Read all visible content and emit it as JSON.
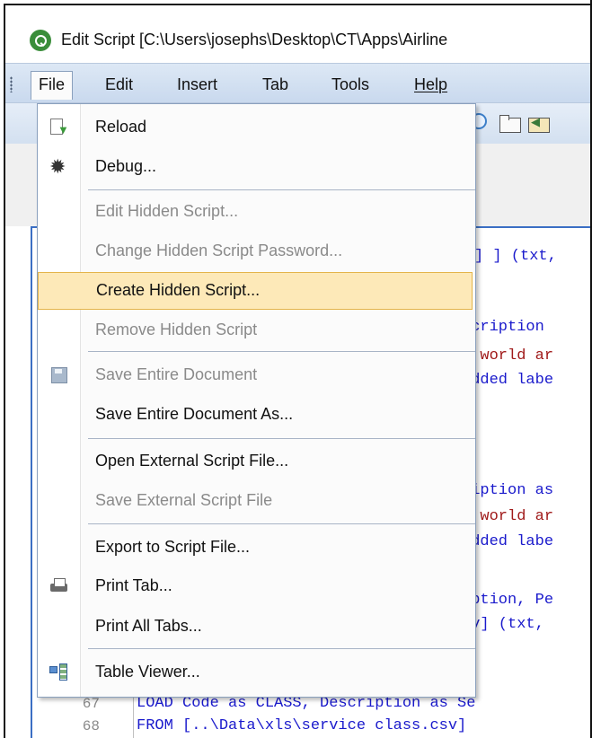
{
  "window": {
    "title": "Edit Script [C:\\Users\\josephs\\Desktop\\CT\\Apps\\Airline"
  },
  "menubar": {
    "items": [
      "File",
      "Edit",
      "Insert",
      "Tab",
      "Tools",
      "Help"
    ]
  },
  "file_menu": {
    "items": [
      {
        "label": "Reload",
        "icon": "reload-icon",
        "enabled": true
      },
      {
        "label": "Debug...",
        "icon": "debug-icon",
        "enabled": true
      },
      {
        "label": "Edit Hidden Script...",
        "enabled": false
      },
      {
        "label": "Change Hidden Script Password...",
        "enabled": false
      },
      {
        "label": "Create Hidden Script...",
        "enabled": true,
        "highlighted": true
      },
      {
        "label": "Remove Hidden Script",
        "enabled": false
      },
      {
        "label": "Save Entire Document",
        "icon": "save-icon",
        "enabled": false
      },
      {
        "label": "Save Entire Document As...",
        "enabled": true
      },
      {
        "label": "Open External Script File...",
        "enabled": true
      },
      {
        "label": "Save External Script File",
        "enabled": false
      },
      {
        "label": "Export to Script File...",
        "enabled": true
      },
      {
        "label": "Print Tab...",
        "icon": "print-icon",
        "enabled": true
      },
      {
        "label": "Print All Tabs...",
        "enabled": true
      },
      {
        "label": "Table Viewer...",
        "icon": "table-viewer-icon",
        "enabled": true
      }
    ]
  },
  "editor": {
    "visible_fragments": [
      "] (txt,",
      "scription",
      "c world ar",
      "edded labe",
      "ription as",
      "c world ar",
      "edded labe",
      "iption, Pe",
      "sv] (txt,"
    ],
    "lines": [
      {
        "number": "67",
        "text": "LOAD Code as CLASS, Description as Se"
      },
      {
        "number": "68",
        "text": "FROM [..\\Data\\xls\\service class.csv]"
      }
    ]
  },
  "colors": {
    "highlight": "#fde9b8",
    "highlight_border": "#e4b44a",
    "keyword": "#1a1acc",
    "string": "#a01a1a"
  }
}
